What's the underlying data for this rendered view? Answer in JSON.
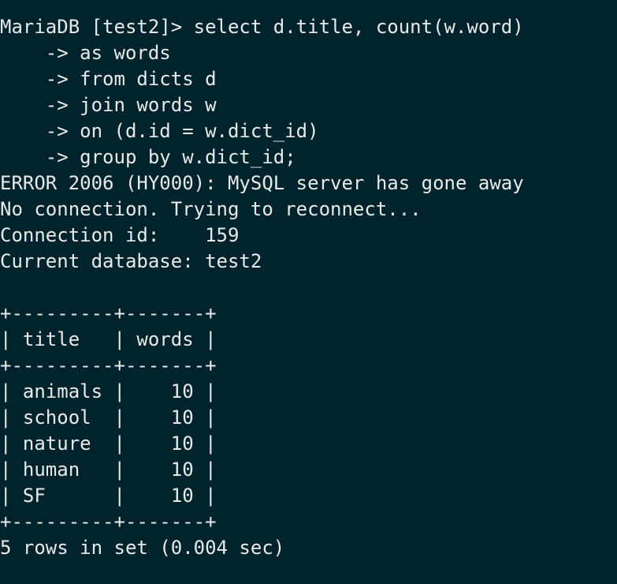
{
  "terminal": {
    "lines": [
      "MariaDB [test2]> select d.title, count(w.word)",
      "    -> as words",
      "    -> from dicts d",
      "    -> join words w",
      "    -> on (d.id = w.dict_id)",
      "    -> group by w.dict_id;",
      "ERROR 2006 (HY000): MySQL server has gone away",
      "No connection. Trying to reconnect...",
      "Connection id:    159",
      "Current database: test2",
      "",
      "+---------+-------+",
      "| title   | words |",
      "+---------+-------+",
      "| animals |    10 |",
      "| school  |    10 |",
      "| nature  |    10 |",
      "| human   |    10 |",
      "| SF      |    10 |",
      "+---------+-------+",
      "5 rows in set (0.004 sec)"
    ]
  },
  "colors": {
    "background": "#01232c",
    "text": "#e8eaea"
  }
}
